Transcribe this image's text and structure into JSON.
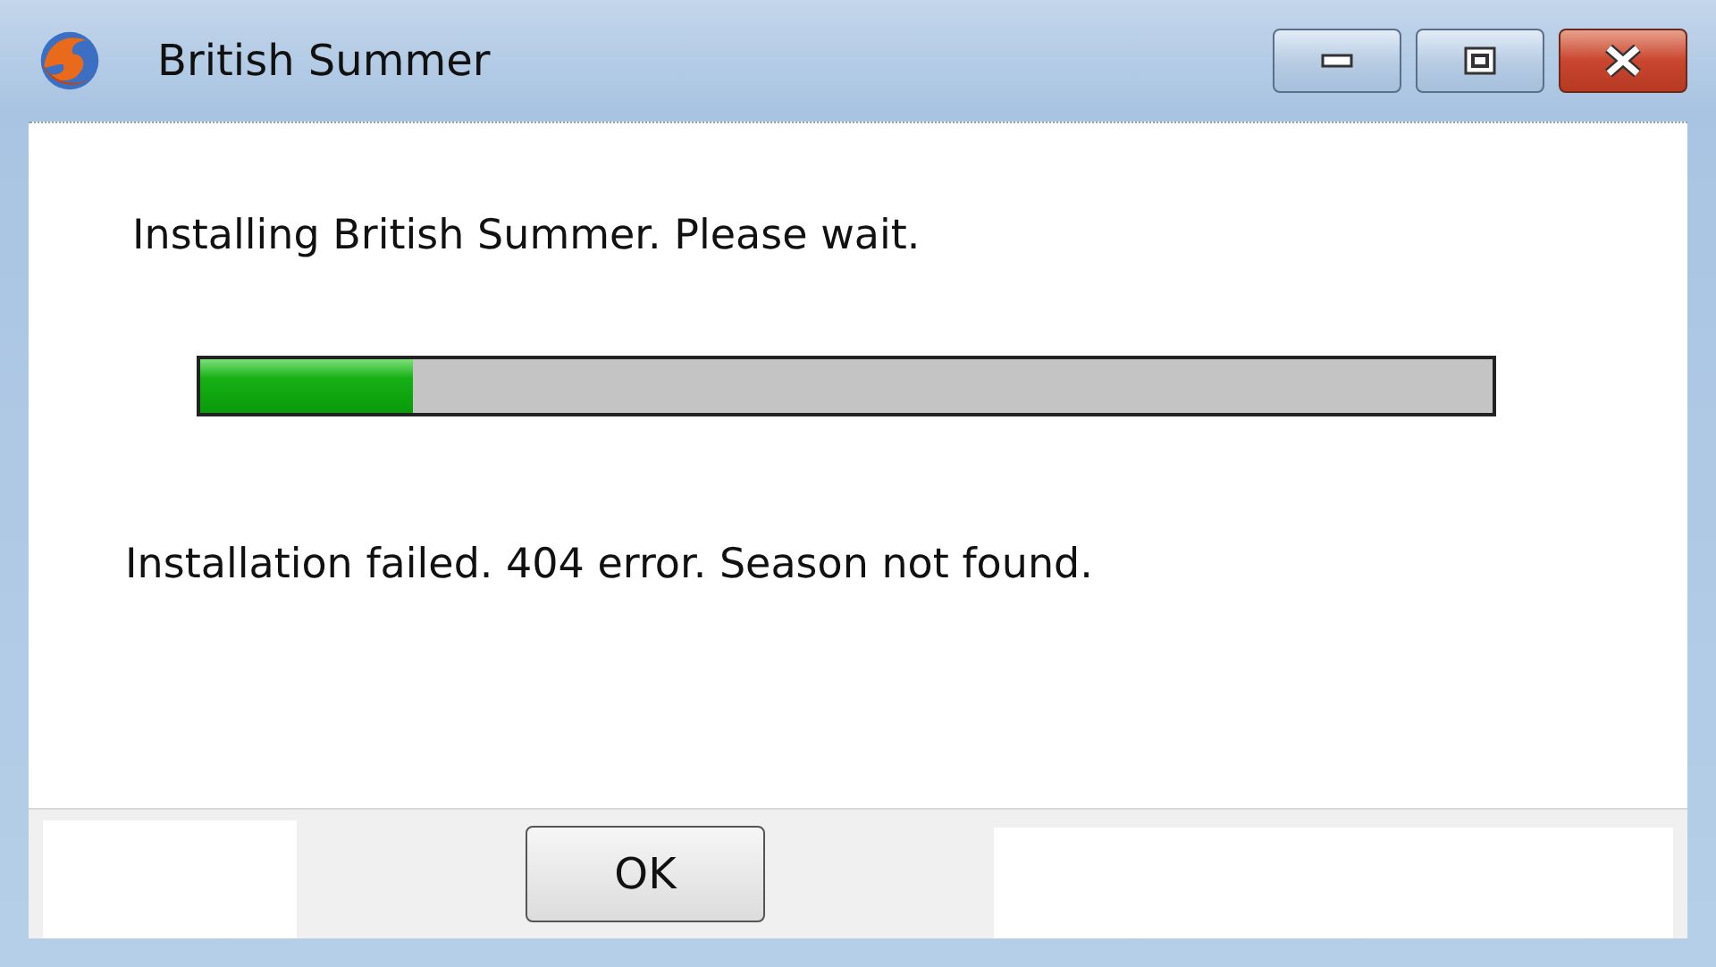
{
  "window": {
    "title": "British Summer"
  },
  "message": "Installing British Summer. Please wait.",
  "progress": {
    "level": 0.165
  },
  "error": "Installation failed. 404 error. Season not found.",
  "buttons": [
    "OK"
  ]
}
